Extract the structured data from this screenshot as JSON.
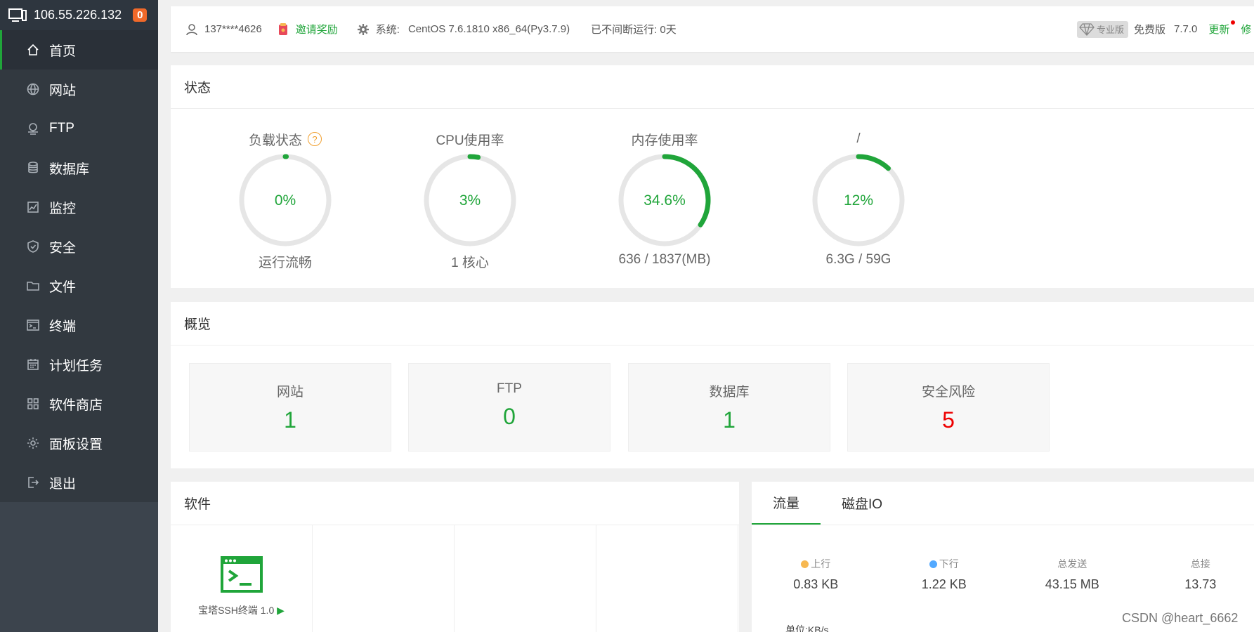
{
  "sidebar": {
    "server_ip": "106.55.226.132",
    "badge": "0",
    "items": [
      {
        "label": "首页",
        "icon": "home-icon"
      },
      {
        "label": "网站",
        "icon": "globe-icon"
      },
      {
        "label": "FTP",
        "icon": "ftp-icon"
      },
      {
        "label": "数据库",
        "icon": "database-icon"
      },
      {
        "label": "监控",
        "icon": "monitor-chart-icon"
      },
      {
        "label": "安全",
        "icon": "shield-icon"
      },
      {
        "label": "文件",
        "icon": "folder-icon"
      },
      {
        "label": "终端",
        "icon": "terminal-icon"
      },
      {
        "label": "计划任务",
        "icon": "calendar-icon"
      },
      {
        "label": "软件商店",
        "icon": "grid-icon"
      },
      {
        "label": "面板设置",
        "icon": "gear-icon"
      },
      {
        "label": "退出",
        "icon": "logout-icon"
      }
    ]
  },
  "topbar": {
    "user": "137****4626",
    "invite": "邀请奖励",
    "system_label": "系统:",
    "system_value": "CentOS 7.6.1810 x86_64(Py3.7.9)",
    "uptime": "已不间断运行: 0天",
    "pro_tag": "专业版",
    "edition": "免费版",
    "version": "7.7.0",
    "update": "更新",
    "fix": "修"
  },
  "status": {
    "title": "状态",
    "gauges": [
      {
        "title": "负载状态",
        "value": "0%",
        "sub": "运行流畅",
        "fraction": 0.0
      },
      {
        "title": "CPU使用率",
        "value": "3%",
        "sub": "1 核心",
        "fraction": 0.03
      },
      {
        "title": "内存使用率",
        "value": "34.6%",
        "sub": "636 / 1837(MB)",
        "fraction": 0.346
      },
      {
        "title": "/",
        "value": "12%",
        "sub": "6.3G / 59G",
        "fraction": 0.12
      }
    ]
  },
  "overview": {
    "title": "概览",
    "cards": [
      {
        "label": "网站",
        "value": "1"
      },
      {
        "label": "FTP",
        "value": "0"
      },
      {
        "label": "数据库",
        "value": "1"
      },
      {
        "label": "安全风险",
        "value": "5"
      }
    ]
  },
  "software": {
    "title": "软件",
    "items": [
      {
        "name": "宝塔SSH终端 1.0",
        "play": "▶"
      }
    ]
  },
  "traffic": {
    "tabs": [
      "流量",
      "磁盘IO"
    ],
    "stats": [
      {
        "label": "上行",
        "value": "0.83 KB",
        "dot": "#f7b851"
      },
      {
        "label": "下行",
        "value": "1.22 KB",
        "dot": "#52a9ff"
      },
      {
        "label": "总发送",
        "value": "43.15 MB"
      },
      {
        "label": "总接",
        "value": "13.73"
      }
    ],
    "unit": "单位:KB/s"
  },
  "watermark": "CSDN @heart_6662",
  "colors": {
    "accent": "#20a53a",
    "danger": "#e00000",
    "sidebar": "#3c444d"
  }
}
